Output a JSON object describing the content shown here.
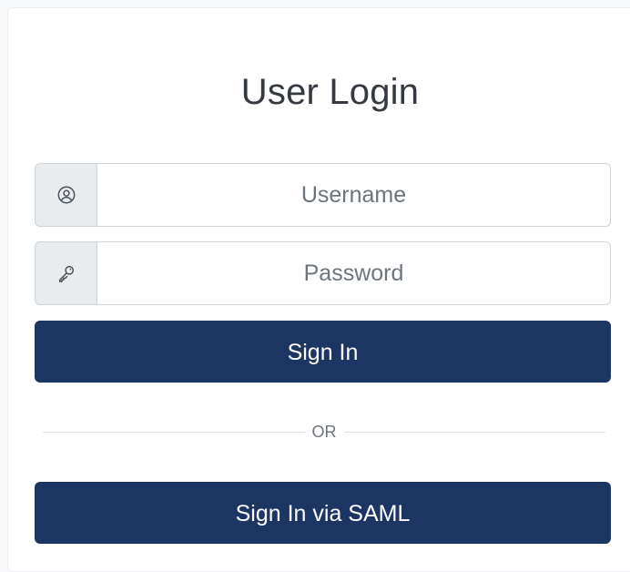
{
  "login": {
    "title": "User Login",
    "username": {
      "icon": "user-circle-icon",
      "placeholder": "Username",
      "value": ""
    },
    "password": {
      "icon": "key-icon",
      "placeholder": "Password",
      "value": ""
    },
    "sign_in_label": "Sign In",
    "divider_text": "OR",
    "saml_label": "Sign In via SAML"
  },
  "colors": {
    "primary": "#1c3664",
    "addon_bg": "#e9ecef",
    "border": "#ced4da",
    "title_text": "#343a40"
  }
}
